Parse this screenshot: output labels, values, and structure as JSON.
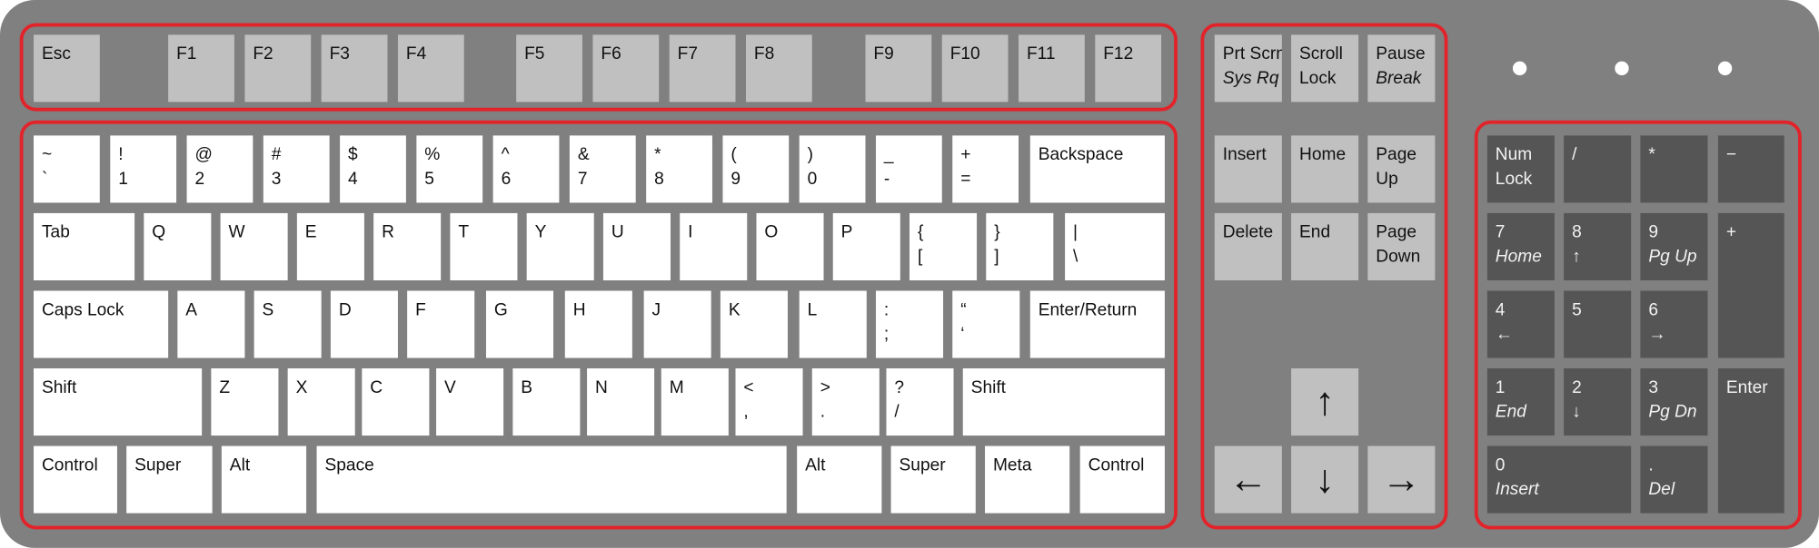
{
  "keyboard": {
    "function_row": [
      [
        "Esc"
      ],
      [
        "F1"
      ],
      [
        "F2"
      ],
      [
        "F3"
      ],
      [
        "F4"
      ],
      [
        "F5"
      ],
      [
        "F6"
      ],
      [
        "F7"
      ],
      [
        "F8"
      ],
      [
        "F9"
      ],
      [
        "F10"
      ],
      [
        "F11"
      ],
      [
        "F12"
      ]
    ],
    "main_rows": [
      [
        [
          "~",
          "`"
        ],
        [
          "!",
          "1"
        ],
        [
          "@",
          "2"
        ],
        [
          "#",
          "3"
        ],
        [
          "$",
          "4"
        ],
        [
          "%",
          "5"
        ],
        [
          "^",
          "6"
        ],
        [
          "&",
          "7"
        ],
        [
          "*",
          "8"
        ],
        [
          "(",
          "9"
        ],
        [
          ")",
          "0"
        ],
        [
          "_",
          "-"
        ],
        [
          "+",
          "="
        ],
        [
          "Backspace"
        ]
      ],
      [
        [
          "Tab"
        ],
        [
          "Q"
        ],
        [
          "W"
        ],
        [
          "E"
        ],
        [
          "R"
        ],
        [
          "T"
        ],
        [
          "Y"
        ],
        [
          "U"
        ],
        [
          "I"
        ],
        [
          "O"
        ],
        [
          "P"
        ],
        [
          "{",
          "["
        ],
        [
          "}",
          "]"
        ],
        [
          "|",
          "\\"
        ]
      ],
      [
        [
          "Caps Lock"
        ],
        [
          "A"
        ],
        [
          "S"
        ],
        [
          "D"
        ],
        [
          "F"
        ],
        [
          "G"
        ],
        [
          "H"
        ],
        [
          "J"
        ],
        [
          "K"
        ],
        [
          "L"
        ],
        [
          ":",
          ";"
        ],
        [
          "“",
          "‘"
        ],
        [
          "Enter/Return"
        ]
      ],
      [
        [
          "Shift"
        ],
        [
          "Z"
        ],
        [
          "X"
        ],
        [
          "C"
        ],
        [
          "V"
        ],
        [
          "B"
        ],
        [
          "N"
        ],
        [
          "M"
        ],
        [
          "<",
          ","
        ],
        [
          ">",
          "."
        ],
        [
          "?",
          "/"
        ],
        [
          "Shift"
        ]
      ],
      [
        [
          "Control"
        ],
        [
          "Super"
        ],
        [
          "Alt"
        ],
        [
          "Space"
        ],
        [
          "Alt"
        ],
        [
          "Super"
        ],
        [
          "Meta"
        ],
        [
          "Control"
        ]
      ]
    ],
    "navigation": [
      [
        "Prt Scrn",
        "Sys Rq"
      ],
      [
        "Scroll",
        "Lock"
      ],
      [
        "Pause",
        "Break"
      ],
      [
        "Insert"
      ],
      [
        "Home"
      ],
      [
        "Page",
        "Up"
      ],
      [
        "Delete"
      ],
      [
        "End"
      ],
      [
        "Page",
        "Down"
      ]
    ],
    "arrows": [
      [
        "↑"
      ],
      [
        "←"
      ],
      [
        "↓"
      ],
      [
        "→"
      ]
    ],
    "numpad": [
      [
        "Num",
        "Lock"
      ],
      [
        "/"
      ],
      [
        "*"
      ],
      [
        "−"
      ],
      [
        "7",
        "Home"
      ],
      [
        "8",
        "↑"
      ],
      [
        "9",
        "Pg Up"
      ],
      [
        "+"
      ],
      [
        "4",
        "←"
      ],
      [
        "5"
      ],
      [
        "6",
        "→"
      ],
      [
        "1",
        "End"
      ],
      [
        "2",
        "↓"
      ],
      [
        "3",
        "Pg Dn"
      ],
      [
        "Enter"
      ],
      [
        "0",
        "Insert"
      ],
      [
        ".",
        "Del"
      ]
    ],
    "colors": {
      "body": "#808080",
      "highlight": "#e2232a",
      "standard_key": "#ffffff",
      "function_key": "#c0c0c0",
      "numpad_key": "#555555"
    }
  }
}
